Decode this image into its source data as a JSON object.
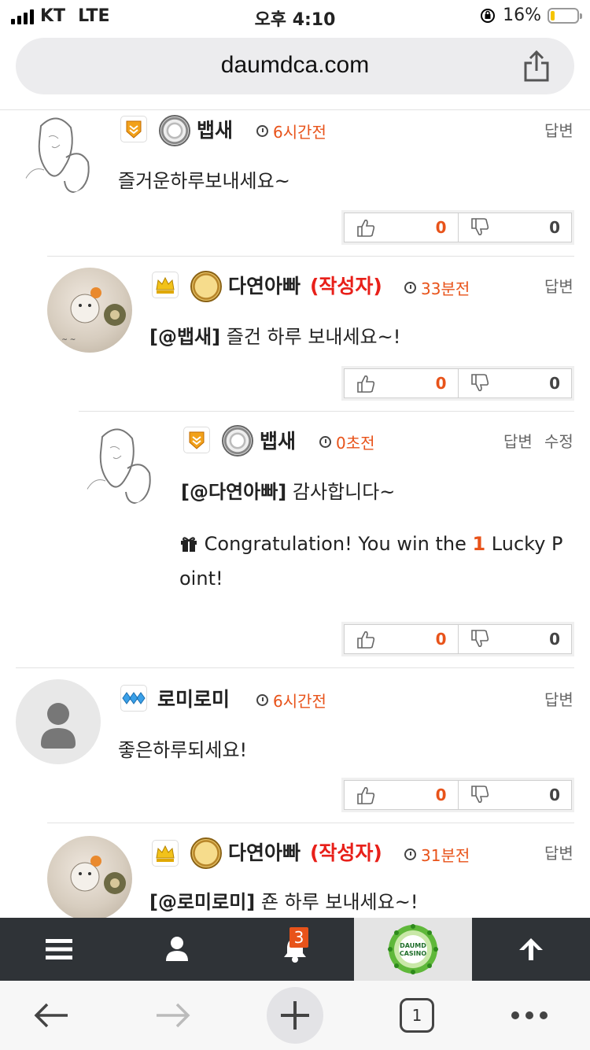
{
  "status": {
    "carrier": "KT",
    "network": "LTE",
    "time": "오후 4:10",
    "battery": "16%",
    "battery_fraction": 0.16
  },
  "browser": {
    "url": "daumdca.com"
  },
  "labels": {
    "reply": "답변",
    "edit": "수정",
    "author_tag": "(작성자)"
  },
  "comments": [
    {
      "name": "뱁새",
      "time": "6시간전",
      "body": "즐거운하루보내세요~",
      "up": "0",
      "down": "0"
    },
    {
      "name": "다연아빠",
      "author_tag": "(작성자)",
      "time": "33분전",
      "mention": "[@뱁새]",
      "body": " 즐건 하루 보내세요~!",
      "up": "0",
      "down": "0"
    },
    {
      "name": "뱁새",
      "time": "0초전",
      "mention": "[@다연아빠]",
      "body": " 감사합니다~",
      "lucky": {
        "prefix": "Congratulation! You win the ",
        "points": "1",
        "suffix_line1": " Lucky P",
        "suffix_line2": "oint!"
      },
      "up": "0",
      "down": "0"
    },
    {
      "name": "로미로미",
      "time": "6시간전",
      "body": "좋은하루되세요!",
      "up": "0",
      "down": "0"
    },
    {
      "name": "다연아빠",
      "author_tag": "(작성자)",
      "time": "31분전",
      "mention": "[@로미로미]",
      "body": " 죤 하루 보내세요~!"
    }
  ],
  "appbar": {
    "notification_count": "3",
    "logo_line1": "DAUMD",
    "logo_line2": "CASINO"
  },
  "browserbar": {
    "tab_count": "1"
  },
  "colors": {
    "accent": "#e8531a",
    "author": "#e8201a",
    "appbar_bg": "#2f3337"
  }
}
